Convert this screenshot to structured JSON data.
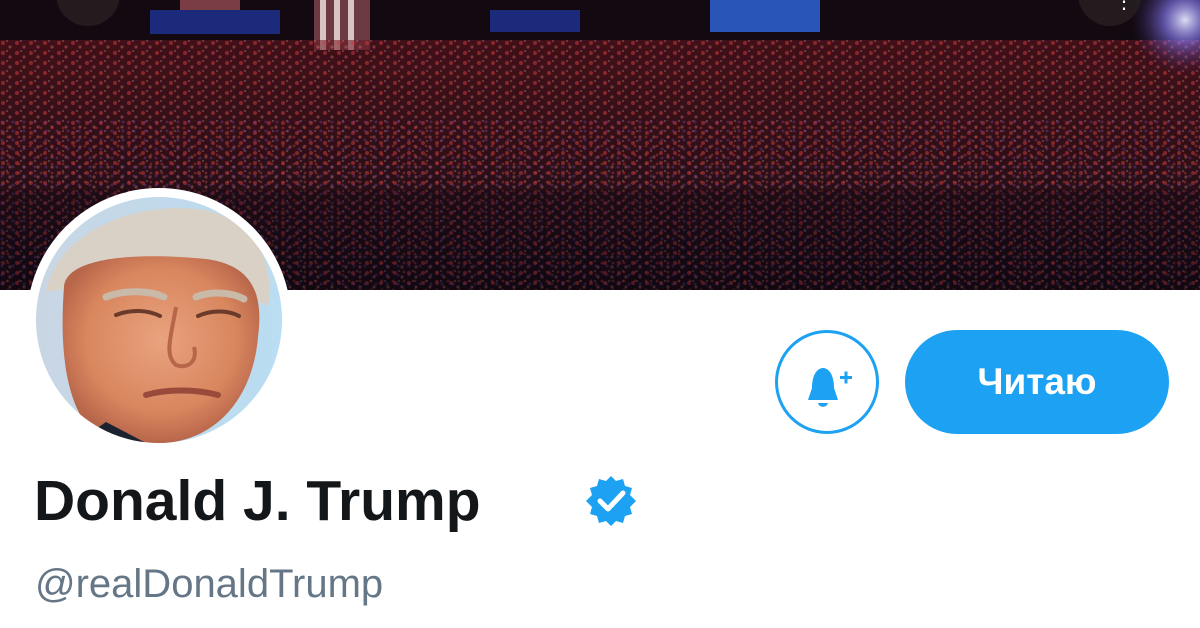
{
  "profile": {
    "display_name": "Donald J. Trump",
    "handle": "@realDonaldTrump",
    "verified": true
  },
  "actions": {
    "follow_label": "Читаю"
  },
  "icons": {
    "notify": "bell-plus-icon",
    "verified": "verified-badge-icon"
  },
  "colors": {
    "accent": "#1da1f2",
    "name_text": "#14171a",
    "handle_text": "#657786"
  }
}
